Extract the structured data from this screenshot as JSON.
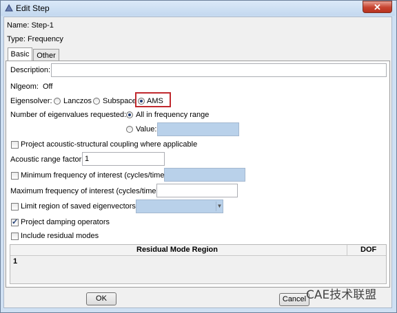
{
  "window": {
    "title": "Edit Step",
    "close_glyph": "✕"
  },
  "name_row": "Name:  Step-1",
  "type_row": "Type:  Frequency",
  "tabs": [
    {
      "label": "Basic"
    },
    {
      "label": "Other"
    }
  ],
  "basic": {
    "description_label": "Description:",
    "description_value": "",
    "nlgeom_label": "Nlgeom:",
    "nlgeom_value": "Off",
    "eigensolver_label": "Eigensolver:",
    "eigensolvers": [
      {
        "label": "Lanczos",
        "selected": false
      },
      {
        "label": "Subspace",
        "selected": false
      },
      {
        "label": "AMS",
        "selected": true
      }
    ],
    "num_eigen_label": "Number of eigenvalues requested:",
    "num_eigen_options": [
      {
        "label": "All in frequency range",
        "selected": true
      },
      {
        "label": "Value:",
        "selected": false
      }
    ],
    "value_field": "",
    "project_acoustic_label": "Project acoustic-structural coupling where applicable",
    "project_acoustic_checked": false,
    "acoustic_range_label": "Acoustic range factor:",
    "acoustic_range_value": "1",
    "min_freq_label": "Minimum frequency of interest (cycles/time):",
    "min_freq_checked": false,
    "min_freq_value": "",
    "max_freq_label": "Maximum frequency of interest (cycles/time):",
    "max_freq_value": "",
    "limit_region_label": "Limit region of saved eigenvectors:",
    "limit_region_checked": false,
    "limit_region_value": "",
    "project_damping_label": "Project damping operators",
    "project_damping_checked": true,
    "include_residual_label": "Include residual modes",
    "include_residual_checked": false,
    "table": {
      "columns": [
        "Residual Mode Region",
        "DOF"
      ],
      "rows": [
        {
          "index": "1",
          "region": "",
          "dof": ""
        }
      ]
    }
  },
  "buttons": {
    "ok": "OK",
    "cancel": "Cancel"
  },
  "watermark": "CAE技术联盟",
  "colors": {
    "highlight": "#c0282d",
    "disabled_field": "#b9d1ea"
  }
}
